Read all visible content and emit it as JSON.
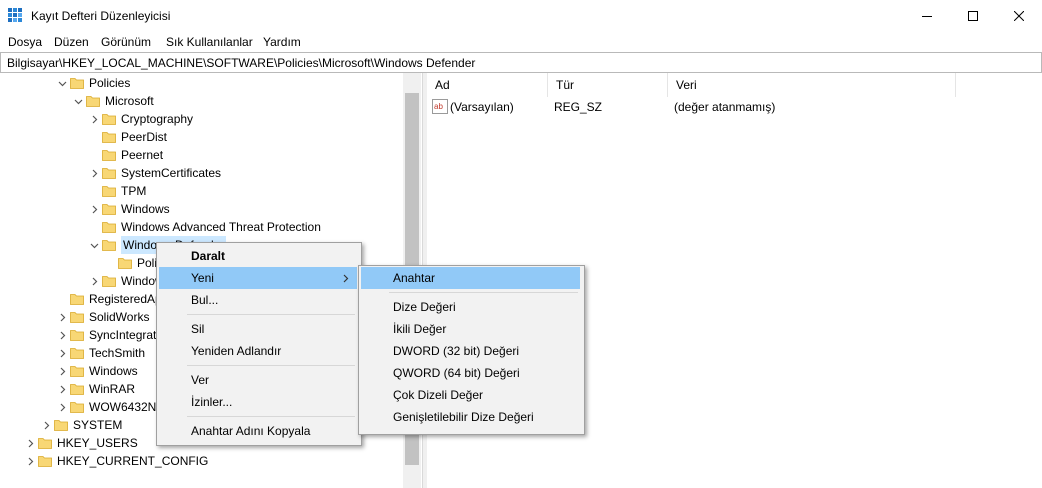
{
  "window": {
    "title": "Kayıt Defteri Düzenleyicisi",
    "controls": [
      "minimize-icon",
      "maximize-icon",
      "close-icon"
    ]
  },
  "menu": [
    "Dosya",
    "Düzen",
    "Görünüm",
    "Sık Kullanılanlar",
    "Yardım"
  ],
  "address": "Bilgisayar\\HKEY_LOCAL_MACHINE\\SOFTWARE\\Policies\\Microsoft\\Windows Defender",
  "tree": [
    {
      "label": "Policies",
      "expander": "expanded"
    },
    {
      "label": "Microsoft",
      "expander": "expanded"
    },
    {
      "label": "Cryptography",
      "expander": "collapsed"
    },
    {
      "label": "PeerDist",
      "expander": "none"
    },
    {
      "label": "Peernet",
      "expander": "none"
    },
    {
      "label": "SystemCertificates",
      "expander": "collapsed"
    },
    {
      "label": "TPM",
      "expander": "none"
    },
    {
      "label": "Windows",
      "expander": "collapsed"
    },
    {
      "label": "Windows Advanced Threat Protection",
      "expander": "none"
    },
    {
      "label": "Windows Defender",
      "expander": "expanded",
      "selected": true
    },
    {
      "label": "Policy Manager",
      "expander": "none"
    },
    {
      "label": "Windows NT",
      "expander": "collapsed"
    },
    {
      "label": "RegisteredApplications",
      "expander": "none"
    },
    {
      "label": "SolidWorks",
      "expander": "collapsed"
    },
    {
      "label": "SyncIntegration",
      "expander": "collapsed"
    },
    {
      "label": "TechSmith",
      "expander": "collapsed"
    },
    {
      "label": "Windows",
      "expander": "collapsed"
    },
    {
      "label": "WinRAR",
      "expander": "collapsed"
    },
    {
      "label": "WOW6432Node",
      "expander": "collapsed"
    },
    {
      "label": "SYSTEM",
      "expander": "collapsed"
    },
    {
      "label": "HKEY_USERS",
      "expander": "collapsed"
    },
    {
      "label": "HKEY_CURRENT_CONFIG",
      "expander": "collapsed"
    }
  ],
  "list": {
    "columns": [
      "Ad",
      "Tür",
      "Veri"
    ],
    "rows": [
      {
        "name": "(Varsayılan)",
        "type": "REG_SZ",
        "data": "(değer atanmamış)",
        "icon": "string-value-icon"
      }
    ]
  },
  "context_menu": {
    "items": [
      {
        "label": "Daralt",
        "bold": true
      },
      {
        "label": "Yeni",
        "submenu": true,
        "highlighted": true
      },
      {
        "label": "Bul..."
      },
      {
        "separator": true
      },
      {
        "label": "Sil"
      },
      {
        "label": "Yeniden Adlandır"
      },
      {
        "separator": true
      },
      {
        "label": "Ver"
      },
      {
        "label": "İzinler..."
      },
      {
        "separator": true
      },
      {
        "label": "Anahtar Adını Kopyala"
      }
    ]
  },
  "submenu": {
    "items": [
      {
        "label": "Anahtar",
        "highlighted": true
      },
      {
        "separator": true
      },
      {
        "label": "Dize Değeri"
      },
      {
        "label": "İkili Değer"
      },
      {
        "label": "DWORD (32 bit) Değeri"
      },
      {
        "label": "QWORD (64 bit) Değeri"
      },
      {
        "label": "Çok Dizeli Değer"
      },
      {
        "label": "Genişletilebilir Dize Değeri"
      }
    ]
  },
  "colors": {
    "selection": "#cce8ff",
    "menu_highlight": "#91c9f7",
    "folder": "#f8d775"
  }
}
